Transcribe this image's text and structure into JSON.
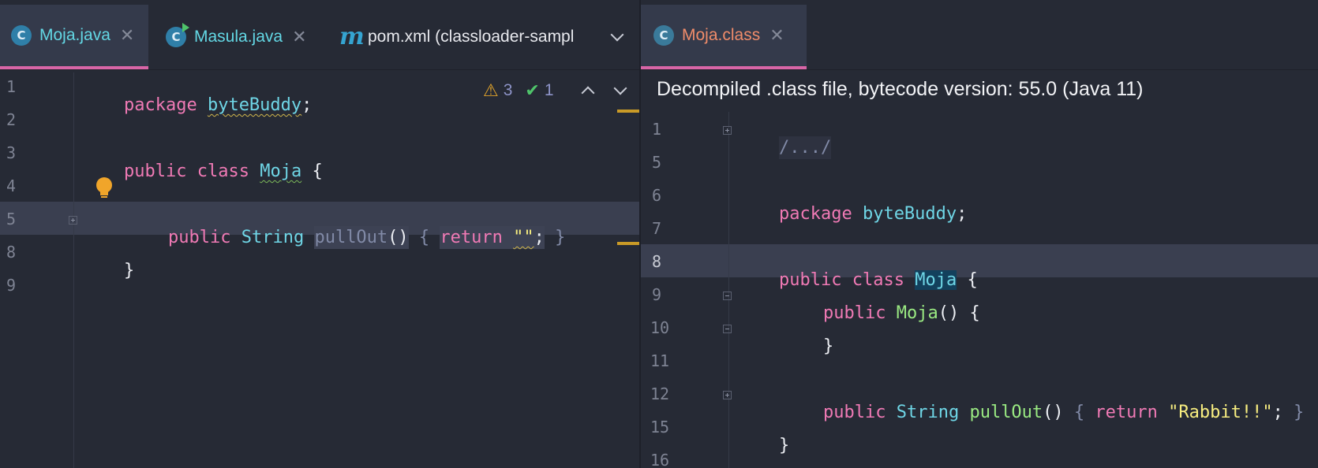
{
  "left_editor": {
    "tabs": [
      {
        "label": "Moja.java",
        "icon": "java-class-icon",
        "icon_glyph": "C",
        "active": true,
        "color": "#63d7e4"
      },
      {
        "label": "Masula.java",
        "icon": "java-runnable-class-icon",
        "icon_glyph": "C",
        "active": false,
        "color": "#63d7e4"
      },
      {
        "label": "pom.xml (classloader-sampl",
        "icon": "maven-icon",
        "icon_glyph": "m",
        "active": false,
        "color": "#e8e9ee"
      }
    ],
    "close_glyph": "✕",
    "inspections": {
      "warnings": "3",
      "ok": "1",
      "warning_glyph": "⚠",
      "ok_glyph": "✔"
    },
    "line_numbers": [
      "1",
      "2",
      "3",
      "4",
      "5",
      "8",
      "9"
    ],
    "code": {
      "kw_package": "package",
      "pkg_name": "byteBuddy",
      "semi": ";",
      "kw_public": "public",
      "kw_class": "class",
      "class_name": "Moja",
      "brace_open": "{",
      "brace_close": "}",
      "type_string": "String",
      "method_name": "pullOut",
      "parens": "()",
      "kw_return": "return",
      "empty_string": "\"\""
    }
  },
  "right_editor": {
    "tabs": [
      {
        "label": "Moja.class",
        "icon": "class-file-icon",
        "icon_glyph": "C",
        "active": true,
        "color": "#f08c6a"
      }
    ],
    "close_glyph": "✕",
    "banner": "Decompiled .class file, bytecode version: 55.0 (Java 11)",
    "line_numbers": [
      "1",
      "5",
      "6",
      "7",
      "8",
      "9",
      "10",
      "11",
      "12",
      "15",
      "16"
    ],
    "code": {
      "folded_header": "/.../",
      "kw_package": "package",
      "pkg_name": "byteBuddy",
      "semi": ";",
      "kw_public": "public",
      "kw_class": "class",
      "class_name": "Moja",
      "brace_open": "{",
      "brace_close": "}",
      "ctor_name": "Moja",
      "parens": "()",
      "type_string": "String",
      "method_name": "pullOut",
      "kw_return": "return",
      "string_literal": "\"Rabbit!!\""
    }
  },
  "colors": {
    "background": "#262a35",
    "keyword": "#f07ab5",
    "type": "#6fd6e6",
    "string": "#f8ee80",
    "method": "#9aea82",
    "active_tab_underline": "#d865a7",
    "warning": "#e0a32b",
    "ok": "#4fc46a"
  }
}
